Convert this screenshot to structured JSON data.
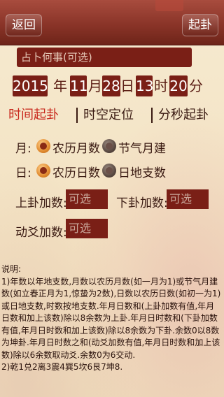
{
  "nav": {
    "back_label": "返回",
    "start_label": "起卦"
  },
  "question": {
    "placeholder": "占卜何事(可选)"
  },
  "date": {
    "year": "2015",
    "year_unit": "年",
    "month": "11",
    "month_unit": "月",
    "day": "28",
    "day_unit": "日",
    "hour": "13",
    "hour_unit": "时",
    "minute": "20",
    "minute_unit": "分"
  },
  "tabs": [
    "时间起卦",
    "时空定位",
    "分秒起卦"
  ],
  "month_option": {
    "label": "月:",
    "options": [
      "农历月数",
      "节气月建"
    ],
    "selected_index": 0
  },
  "day_option": {
    "label": "日:",
    "options": [
      "农历日数",
      "日地支数"
    ],
    "selected_index": 0
  },
  "upper_add": {
    "label": "上卦加数:",
    "placeholder": "可选"
  },
  "lower_add": {
    "label": "下卦加数:",
    "placeholder": "可选"
  },
  "moving_add": {
    "label": "动爻加数:",
    "placeholder": "可选"
  },
  "description": {
    "title": "说明:",
    "text": "1)年数以年地支数,月数以农历月数(如一月为1)或节气月建数(如立春正月为1,惊蛰为2数),日数以农历日数(如初一为1)或日地支数,时数按地支数.年月日数和(上卦加数有值,年月日数和加上该数)除以8余数为上卦.年月日时数和(下卦加数有值,年月日时数和加上该数)除以8余数为下卦.余数0以8数为坤卦.年月日时数之和(动爻加数有值,年月日时数和加上该数)除以6余数取动爻.余数0为6交动.",
    "text2": "2)乾1兑2离3震4巽5坎6艮7坤8."
  }
}
